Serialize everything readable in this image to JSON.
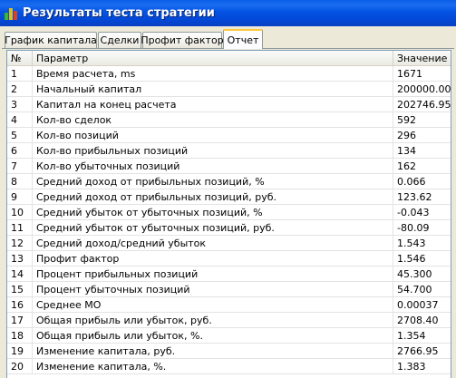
{
  "window": {
    "title": "Результаты теста стратегии",
    "icon": "bar-chart-icon"
  },
  "tabs": [
    {
      "label": "График капитала",
      "active": false
    },
    {
      "label": "Сделки",
      "active": false
    },
    {
      "label": "Профит фактор",
      "active": false
    },
    {
      "label": "Отчет",
      "active": true
    }
  ],
  "table": {
    "headers": {
      "num": "№",
      "param": "Параметр",
      "value": "Значение"
    },
    "rows": [
      {
        "num": "1",
        "param": "Время расчета, ms",
        "value": "1671"
      },
      {
        "num": "2",
        "param": "Начальный капитал",
        "value": "200000.00"
      },
      {
        "num": "3",
        "param": "Капитал на конец расчета",
        "value": "202746.95"
      },
      {
        "num": "4",
        "param": "Кол-во сделок",
        "value": "592"
      },
      {
        "num": "5",
        "param": "Кол-во позиций",
        "value": "296"
      },
      {
        "num": "6",
        "param": "Кол-во прибыльных позиций",
        "value": "134"
      },
      {
        "num": "7",
        "param": "Кол-во убыточных позиций",
        "value": "162"
      },
      {
        "num": "8",
        "param": "Средний доход от прибыльных позиций, %",
        "value": "0.066"
      },
      {
        "num": "9",
        "param": "Средний доход от прибыльных позиций, руб.",
        "value": "123.62"
      },
      {
        "num": "10",
        "param": "Средний убыток от убыточных позиций, %",
        "value": "-0.043"
      },
      {
        "num": "11",
        "param": "Средний убыток от убыточных позиций, руб.",
        "value": "-80.09"
      },
      {
        "num": "12",
        "param": "Средний доход/средний убыток",
        "value": "1.543"
      },
      {
        "num": "13",
        "param": "Профит фактор",
        "value": "1.546"
      },
      {
        "num": "14",
        "param": "Процент прибыльных позиций",
        "value": "45.300"
      },
      {
        "num": "15",
        "param": "Процент убыточных позиций",
        "value": "54.700"
      },
      {
        "num": "16",
        "param": "Среднее МО",
        "value": "0.00037"
      },
      {
        "num": "17",
        "param": "Общая прибыль или убыток, руб.",
        "value": "2708.40"
      },
      {
        "num": "18",
        "param": "Общая прибыль или убыток, %.",
        "value": "1.354"
      },
      {
        "num": "19",
        "param": "Изменение капитала, руб.",
        "value": "2766.95"
      },
      {
        "num": "20",
        "param": "Изменение капитала, %.",
        "value": "1.383"
      }
    ]
  }
}
